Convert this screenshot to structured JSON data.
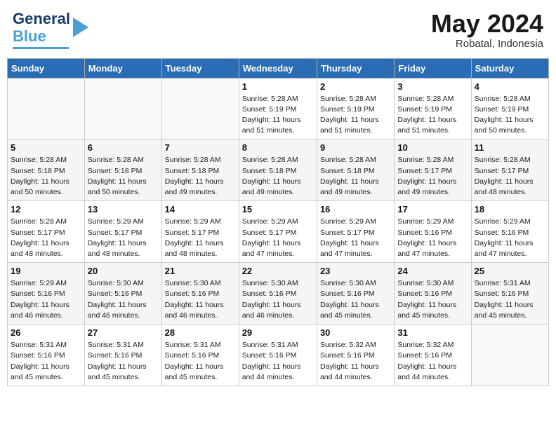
{
  "logo": {
    "line1": "General",
    "line2": "Blue"
  },
  "header": {
    "month": "May 2024",
    "location": "Robatal, Indonesia"
  },
  "days_of_week": [
    "Sunday",
    "Monday",
    "Tuesday",
    "Wednesday",
    "Thursday",
    "Friday",
    "Saturday"
  ],
  "weeks": [
    [
      {
        "day": "",
        "info": ""
      },
      {
        "day": "",
        "info": ""
      },
      {
        "day": "",
        "info": ""
      },
      {
        "day": "1",
        "info": "Sunrise: 5:28 AM\nSunset: 5:19 PM\nDaylight: 11 hours\nand 51 minutes."
      },
      {
        "day": "2",
        "info": "Sunrise: 5:28 AM\nSunset: 5:19 PM\nDaylight: 11 hours\nand 51 minutes."
      },
      {
        "day": "3",
        "info": "Sunrise: 5:28 AM\nSunset: 5:19 PM\nDaylight: 11 hours\nand 51 minutes."
      },
      {
        "day": "4",
        "info": "Sunrise: 5:28 AM\nSunset: 5:19 PM\nDaylight: 11 hours\nand 50 minutes."
      }
    ],
    [
      {
        "day": "5",
        "info": "Sunrise: 5:28 AM\nSunset: 5:18 PM\nDaylight: 11 hours\nand 50 minutes."
      },
      {
        "day": "6",
        "info": "Sunrise: 5:28 AM\nSunset: 5:18 PM\nDaylight: 11 hours\nand 50 minutes."
      },
      {
        "day": "7",
        "info": "Sunrise: 5:28 AM\nSunset: 5:18 PM\nDaylight: 11 hours\nand 49 minutes."
      },
      {
        "day": "8",
        "info": "Sunrise: 5:28 AM\nSunset: 5:18 PM\nDaylight: 11 hours\nand 49 minutes."
      },
      {
        "day": "9",
        "info": "Sunrise: 5:28 AM\nSunset: 5:18 PM\nDaylight: 11 hours\nand 49 minutes."
      },
      {
        "day": "10",
        "info": "Sunrise: 5:28 AM\nSunset: 5:17 PM\nDaylight: 11 hours\nand 49 minutes."
      },
      {
        "day": "11",
        "info": "Sunrise: 5:28 AM\nSunset: 5:17 PM\nDaylight: 11 hours\nand 48 minutes."
      }
    ],
    [
      {
        "day": "12",
        "info": "Sunrise: 5:28 AM\nSunset: 5:17 PM\nDaylight: 11 hours\nand 48 minutes."
      },
      {
        "day": "13",
        "info": "Sunrise: 5:29 AM\nSunset: 5:17 PM\nDaylight: 11 hours\nand 48 minutes."
      },
      {
        "day": "14",
        "info": "Sunrise: 5:29 AM\nSunset: 5:17 PM\nDaylight: 11 hours\nand 48 minutes."
      },
      {
        "day": "15",
        "info": "Sunrise: 5:29 AM\nSunset: 5:17 PM\nDaylight: 11 hours\nand 47 minutes."
      },
      {
        "day": "16",
        "info": "Sunrise: 5:29 AM\nSunset: 5:17 PM\nDaylight: 11 hours\nand 47 minutes."
      },
      {
        "day": "17",
        "info": "Sunrise: 5:29 AM\nSunset: 5:16 PM\nDaylight: 11 hours\nand 47 minutes."
      },
      {
        "day": "18",
        "info": "Sunrise: 5:29 AM\nSunset: 5:16 PM\nDaylight: 11 hours\nand 47 minutes."
      }
    ],
    [
      {
        "day": "19",
        "info": "Sunrise: 5:29 AM\nSunset: 5:16 PM\nDaylight: 11 hours\nand 46 minutes."
      },
      {
        "day": "20",
        "info": "Sunrise: 5:30 AM\nSunset: 5:16 PM\nDaylight: 11 hours\nand 46 minutes."
      },
      {
        "day": "21",
        "info": "Sunrise: 5:30 AM\nSunset: 5:16 PM\nDaylight: 11 hours\nand 46 minutes."
      },
      {
        "day": "22",
        "info": "Sunrise: 5:30 AM\nSunset: 5:16 PM\nDaylight: 11 hours\nand 46 minutes."
      },
      {
        "day": "23",
        "info": "Sunrise: 5:30 AM\nSunset: 5:16 PM\nDaylight: 11 hours\nand 45 minutes."
      },
      {
        "day": "24",
        "info": "Sunrise: 5:30 AM\nSunset: 5:16 PM\nDaylight: 11 hours\nand 45 minutes."
      },
      {
        "day": "25",
        "info": "Sunrise: 5:31 AM\nSunset: 5:16 PM\nDaylight: 11 hours\nand 45 minutes."
      }
    ],
    [
      {
        "day": "26",
        "info": "Sunrise: 5:31 AM\nSunset: 5:16 PM\nDaylight: 11 hours\nand 45 minutes."
      },
      {
        "day": "27",
        "info": "Sunrise: 5:31 AM\nSunset: 5:16 PM\nDaylight: 11 hours\nand 45 minutes."
      },
      {
        "day": "28",
        "info": "Sunrise: 5:31 AM\nSunset: 5:16 PM\nDaylight: 11 hours\nand 45 minutes."
      },
      {
        "day": "29",
        "info": "Sunrise: 5:31 AM\nSunset: 5:16 PM\nDaylight: 11 hours\nand 44 minutes."
      },
      {
        "day": "30",
        "info": "Sunrise: 5:32 AM\nSunset: 5:16 PM\nDaylight: 11 hours\nand 44 minutes."
      },
      {
        "day": "31",
        "info": "Sunrise: 5:32 AM\nSunset: 5:16 PM\nDaylight: 11 hours\nand 44 minutes."
      },
      {
        "day": "",
        "info": ""
      }
    ]
  ]
}
